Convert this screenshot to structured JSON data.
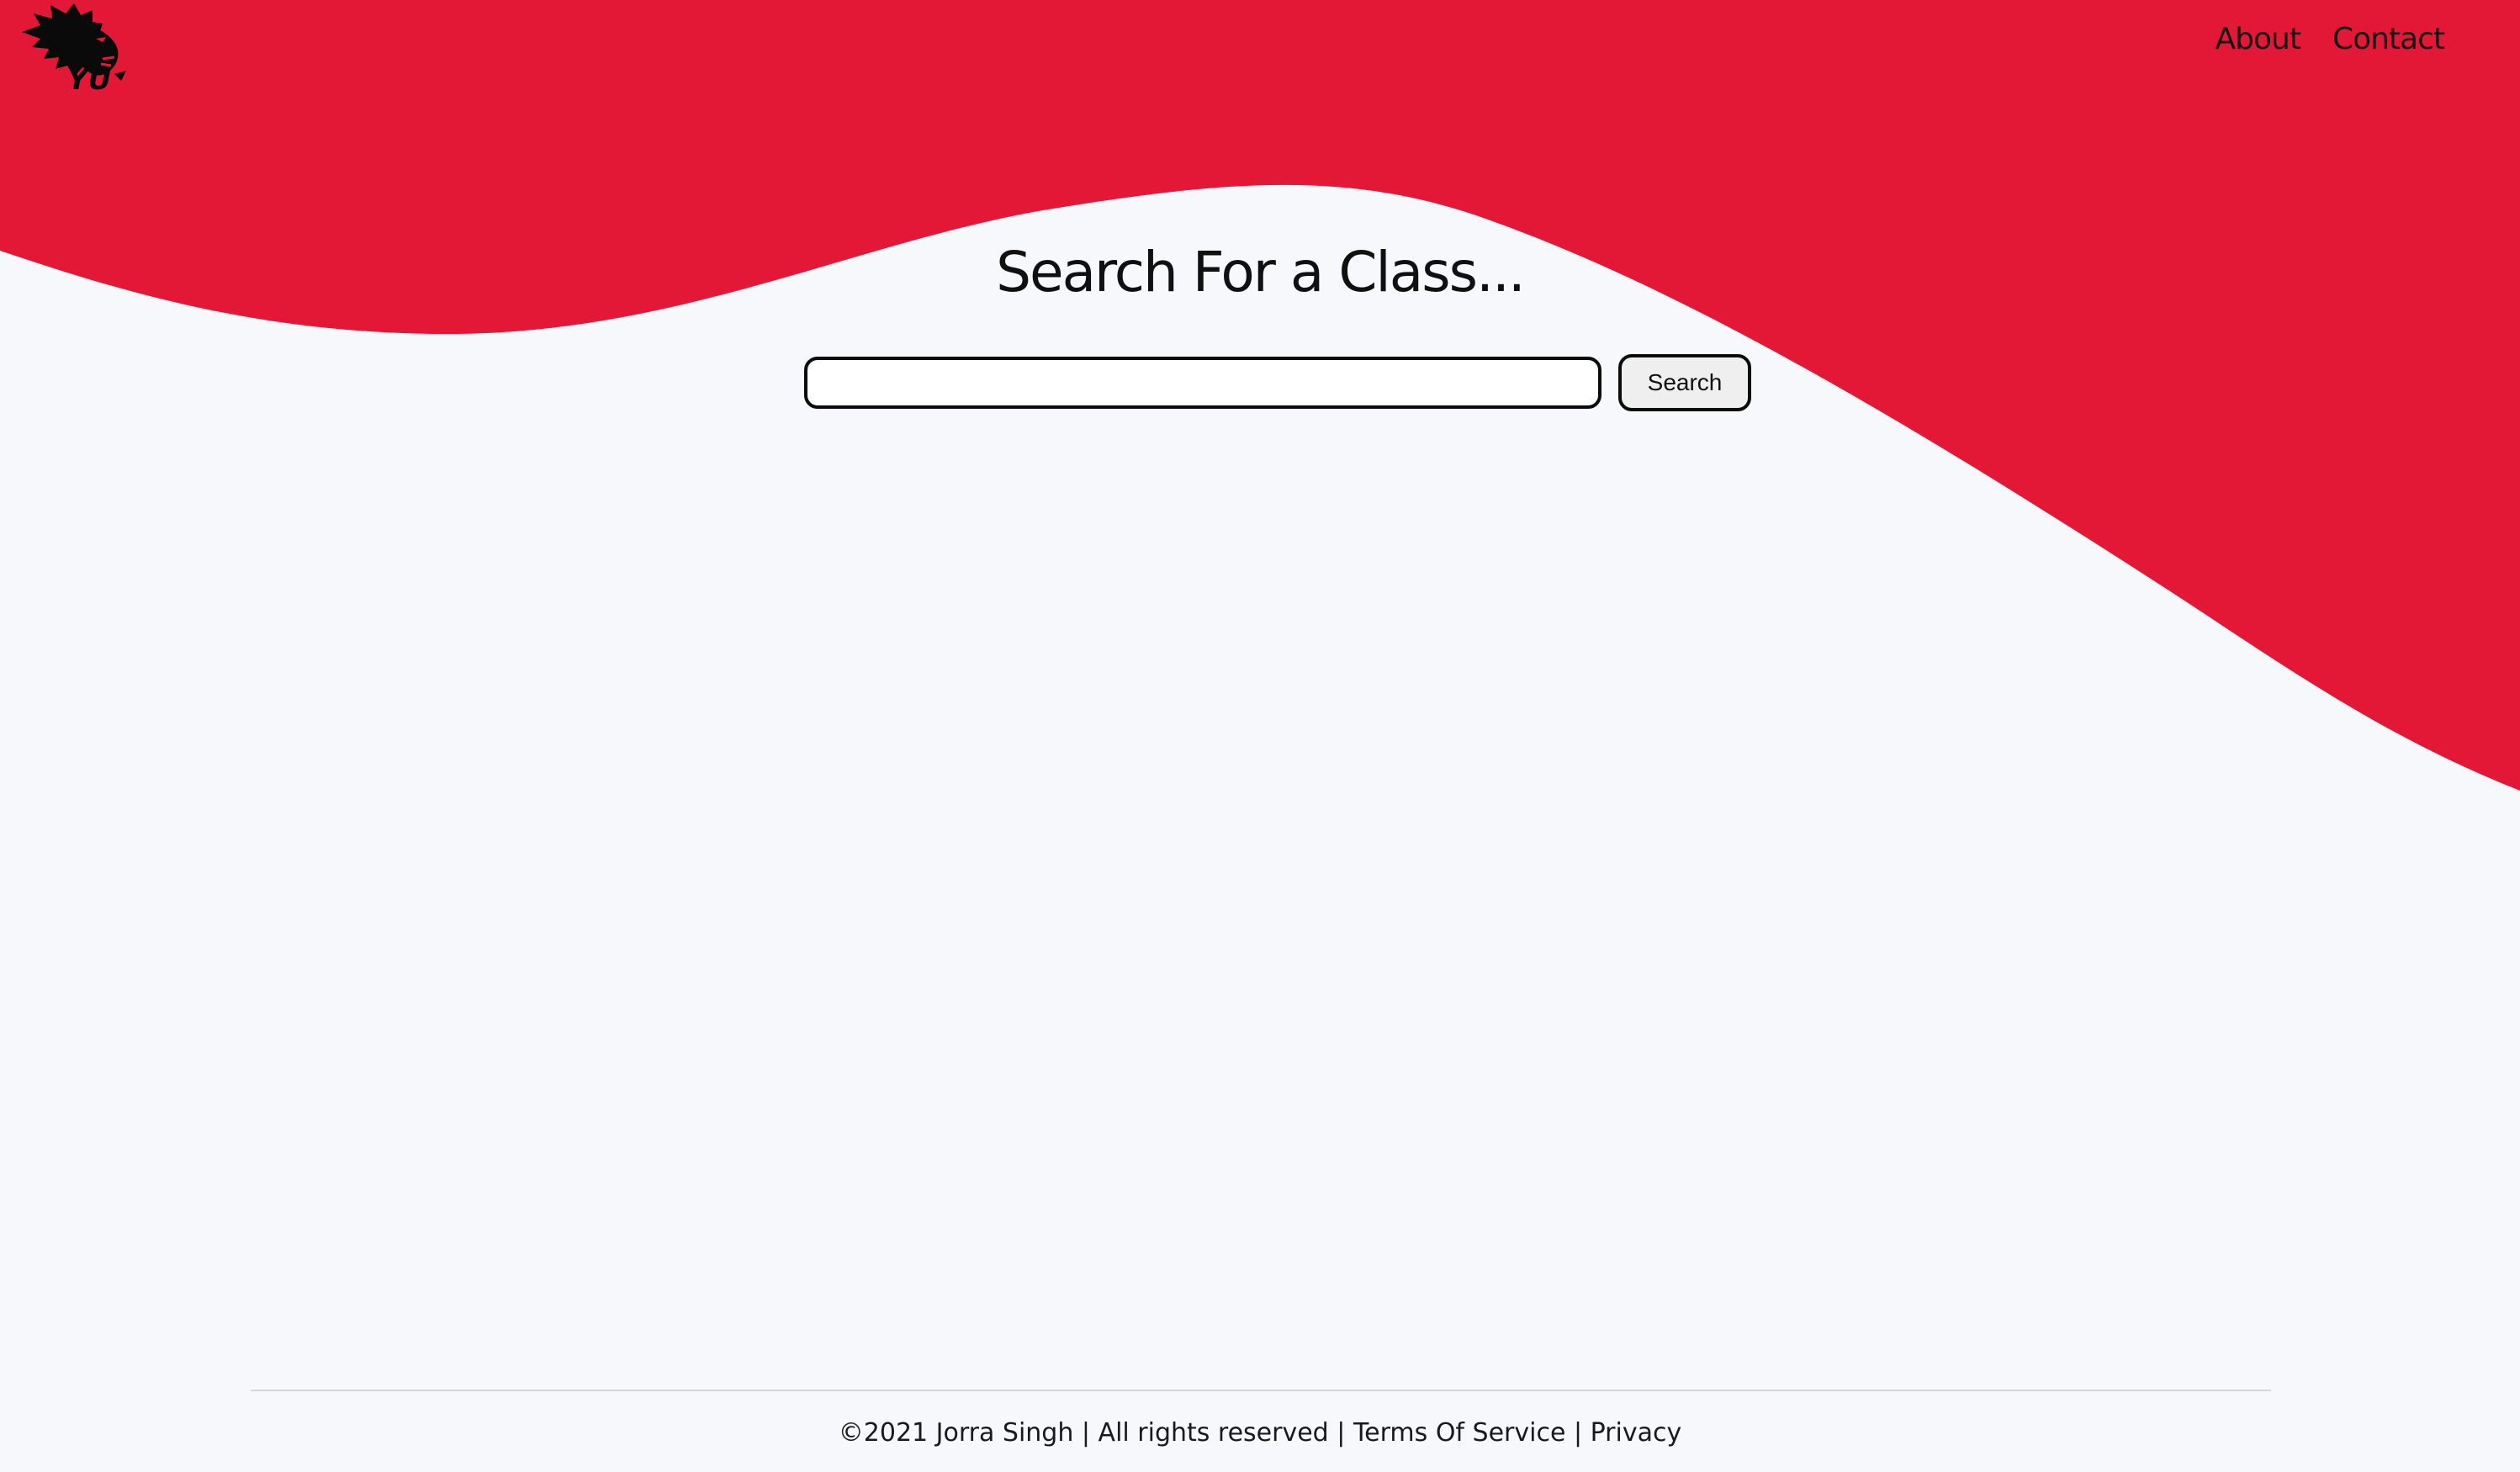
{
  "colors": {
    "brand_red": "#e31837",
    "background": "#f7f8fc"
  },
  "header": {
    "logo": {
      "icon": "lion-head-logo-icon",
      "text": "YU"
    },
    "nav": {
      "about": "About",
      "contact": "Contact"
    }
  },
  "main": {
    "title": "Search For a Class...",
    "search": {
      "value": "",
      "placeholder": "",
      "button_label": "Search"
    }
  },
  "footer": {
    "copyright": "©2021 Jorra Singh | All rights reserved",
    "separator": "|",
    "terms": "Terms Of Service",
    "privacy": "Privacy"
  }
}
